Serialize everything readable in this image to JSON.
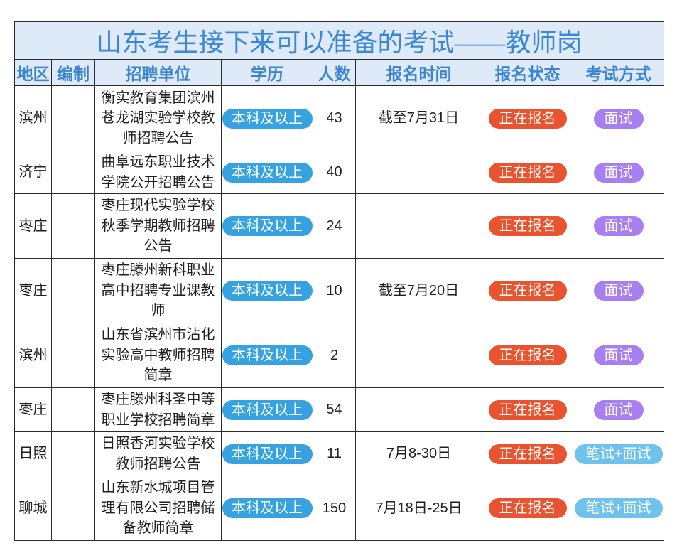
{
  "title": "山东考生接下来可以准备的考试——教师岗",
  "columns": {
    "region": "地区",
    "quota": "编制",
    "unit": "招聘单位",
    "education": "学历",
    "count": "人数",
    "reg_time": "报名时间",
    "status": "报名状态",
    "exam": "考试方式"
  },
  "rows": [
    {
      "region": "滨州",
      "quota": "",
      "unit": "衡实教育集团滨州苍龙湖实验学校教师招聘公告",
      "education": "本科及以上",
      "count": "43",
      "reg_time": "截至7月31日",
      "status": "正在报名",
      "exam": "面试"
    },
    {
      "region": "济宁",
      "quota": "",
      "unit": "曲阜远东职业技术学院公开招聘公告",
      "education": "本科及以上",
      "count": "40",
      "reg_time": "",
      "status": "正在报名",
      "exam": "面试"
    },
    {
      "region": "枣庄",
      "quota": "",
      "unit": "枣庄现代实验学校秋季学期教师招聘公告",
      "education": "本科及以上",
      "count": "24",
      "reg_time": "",
      "status": "正在报名",
      "exam": "面试"
    },
    {
      "region": "枣庄",
      "quota": "",
      "unit": "枣庄滕州新科职业高中招聘专业课教师",
      "education": "本科及以上",
      "count": "10",
      "reg_time": "截至7月20日",
      "status": "正在报名",
      "exam": "面试"
    },
    {
      "region": "滨州",
      "quota": "",
      "unit": "山东省滨州市沾化实验高中教师招聘简章",
      "education": "本科及以上",
      "count": "2",
      "reg_time": "",
      "status": "正在报名",
      "exam": "面试"
    },
    {
      "region": "枣庄",
      "quota": "",
      "unit": "枣庄滕州科圣中等职业学校招聘简章",
      "education": "本科及以上",
      "count": "54",
      "reg_time": "",
      "status": "正在报名",
      "exam": "面试"
    },
    {
      "region": "日照",
      "quota": "",
      "unit": "日照香河实验学校教师招聘公告",
      "education": "本科及以上",
      "count": "11",
      "reg_time": "7月8-30日",
      "status": "正在报名",
      "exam": "笔试+面试"
    },
    {
      "region": "聊城",
      "quota": "",
      "unit": "山东新水城项目管理有限公司招聘储备教师简章",
      "education": "本科及以上",
      "count": "150",
      "reg_time": "7月18日-25日",
      "status": "正在报名",
      "exam": "笔试+面试"
    }
  ],
  "colors": {
    "title_text": "#3a87d6",
    "header_text": "#3a84d2",
    "header_bg": "#dfeaf8",
    "education_badge": "#37a2e0",
    "status_badge": "#e8542f",
    "interview_badge": "#a77ff0",
    "written_interview_badge": "#6fc2ec"
  }
}
